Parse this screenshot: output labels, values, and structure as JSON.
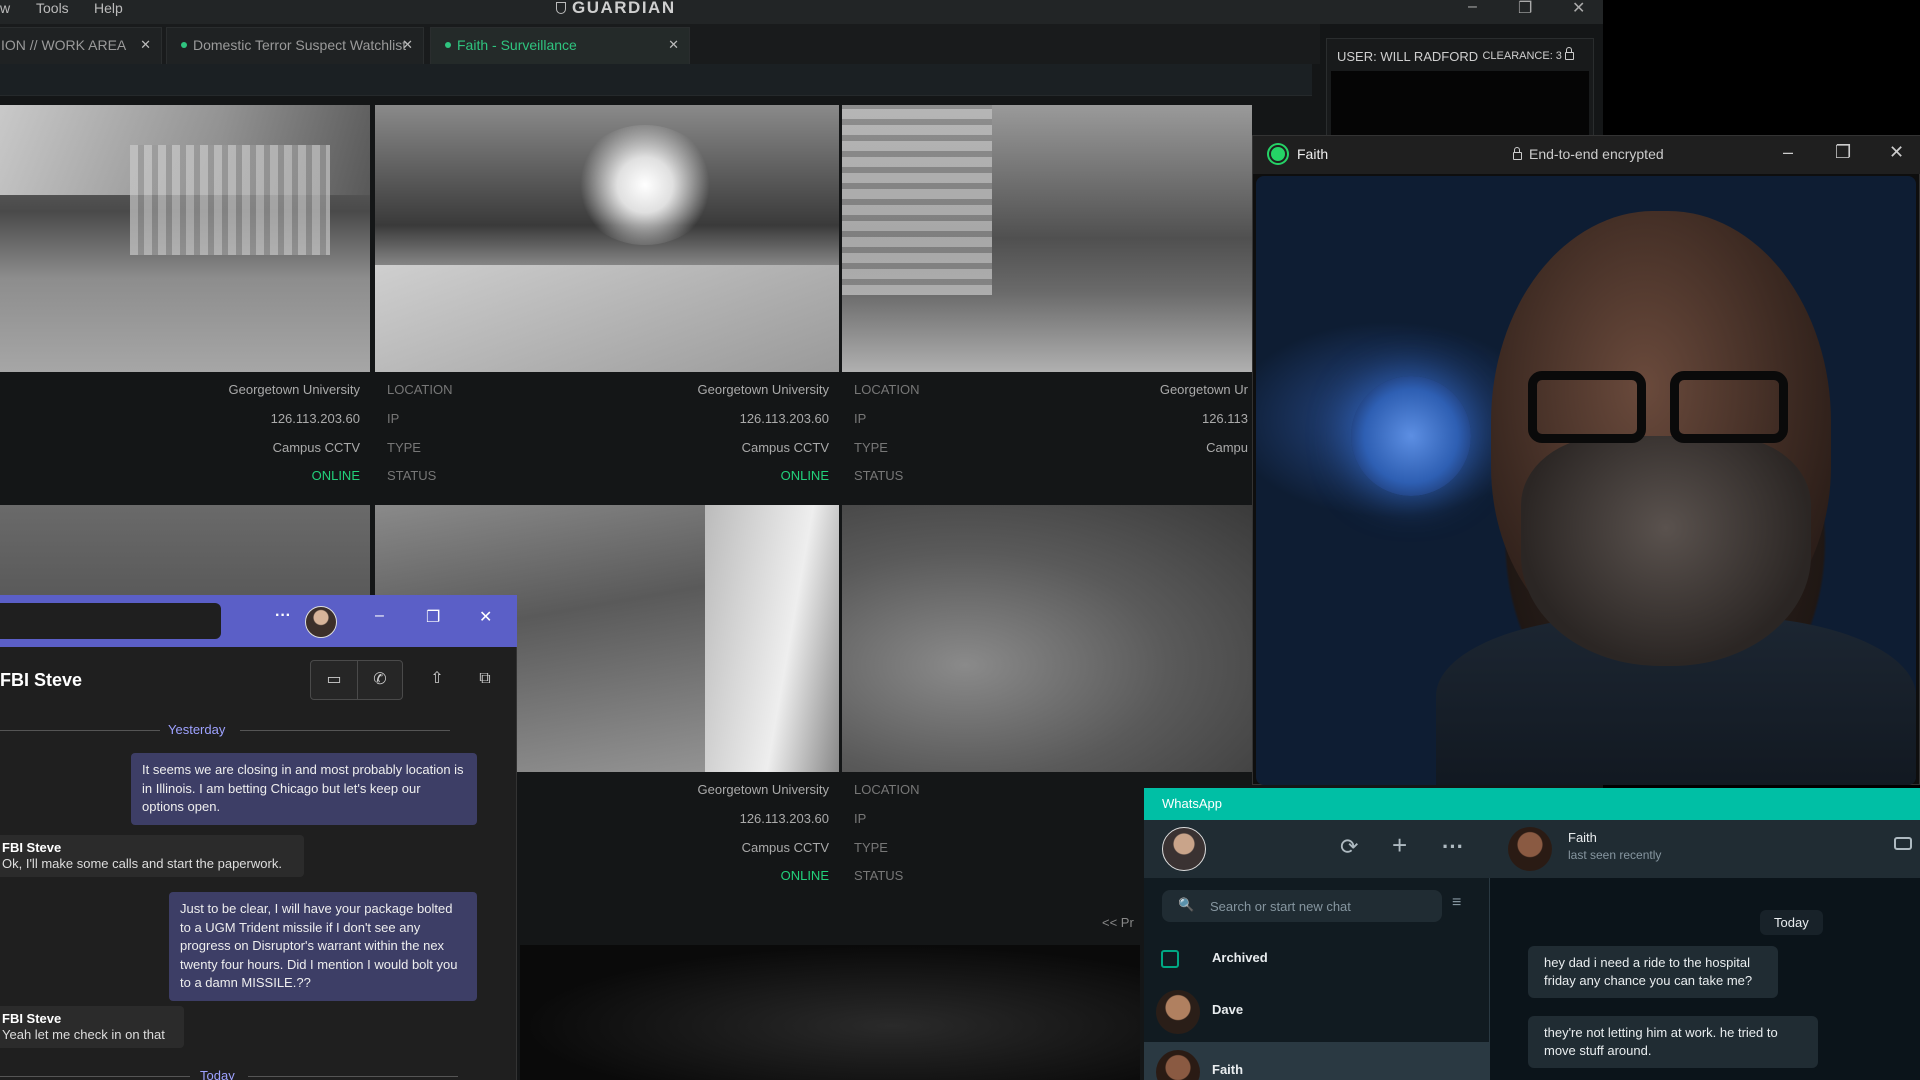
{
  "guardian": {
    "menu": [
      "w",
      "Tools",
      "Help"
    ],
    "title": "GUARDIAN",
    "window_controls": [
      "–",
      "❐",
      "✕"
    ],
    "tabs": [
      {
        "label": "ION // WORK AREA",
        "close": "✕"
      },
      {
        "label": "Domestic Terror Suspect Watchlist",
        "close": "✕"
      },
      {
        "label": "Faith - Surveillance",
        "close": "✕"
      }
    ],
    "user": {
      "label": "USER: WILL RADFORD",
      "clearance": "CLEARANCE: 3"
    },
    "info_keys": {
      "location": "LOCATION",
      "ip": "IP",
      "type": "TYPE",
      "status": "STATUS"
    },
    "cameras": [
      {
        "location": "Georgetown University",
        "ip": "126.113.203.60",
        "type": "Campus CCTV",
        "status": "ONLINE"
      },
      {
        "location": "Georgetown University",
        "ip": "126.113.203.60",
        "type": "Campus CCTV",
        "status": "ONLINE"
      },
      {
        "location": "Georgetown Ur",
        "ip": "126.113",
        "type": "Campu",
        "status": ""
      },
      {
        "location": "Georgetown University",
        "ip": "126.113.203.60",
        "type": "Campus CCTV",
        "status": "ONLINE"
      }
    ],
    "pager": "<< Pr"
  },
  "teams": {
    "contact": "FBI Steve",
    "more": "···",
    "controls": [
      "–",
      "❐",
      "✕"
    ],
    "call_icons": [
      "▭",
      "✆",
      "⇧",
      "⧉"
    ],
    "separators": {
      "yesterday": "Yesterday",
      "today": "Today"
    },
    "messages": [
      {
        "text": "It seems we are closing in and most probably location is in Illinois. I am betting Chicago but let's keep our options open."
      },
      {
        "sender": "FBI Steve",
        "text": "Ok, I'll make some calls and start the paperwork."
      },
      {
        "text": "Just to be clear, I will have your package bolted to a UGM Trident missile if I don't see any progress on Disruptor's warrant within the nex twenty four hours. Did I mention I would bolt you to a damn MISSILE.??"
      },
      {
        "sender": "FBI Steve",
        "text": "Yeah let me check in on that"
      }
    ]
  },
  "video_call": {
    "name": "Faith",
    "encryption": "End-to-end encrypted",
    "controls": [
      "–",
      "❐",
      "✕"
    ]
  },
  "whatsapp": {
    "title": "WhatsApp",
    "icons": [
      "⟳",
      "+",
      "···"
    ],
    "search_placeholder": "Search or start new chat",
    "search_icon": "🔍",
    "filter_icon": "≡",
    "archived": "Archived",
    "chats": [
      "Dave",
      "Faith"
    ],
    "chat": {
      "name": "Faith",
      "status": "last seen recently",
      "day": "Today",
      "messages": [
        "hey dad i need a ride to the hospital friday any chance you can take me?",
        "they're not letting him at work. he tried to move stuff around."
      ]
    }
  },
  "colors": {
    "accent_green": "#22d07a",
    "teams_purple": "#5b5fc7",
    "whatsapp_teal": "#00bfa5"
  }
}
